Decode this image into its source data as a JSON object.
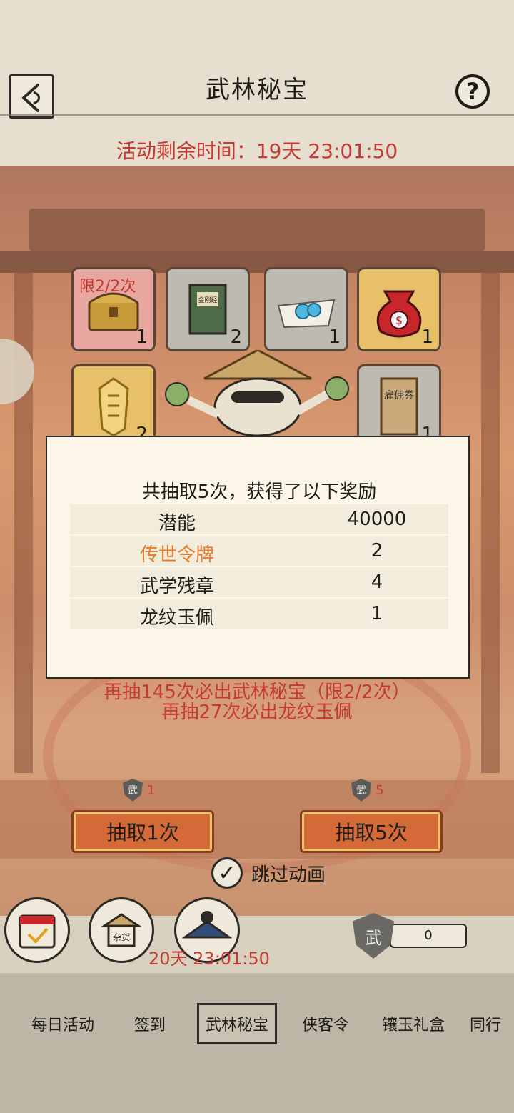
{
  "header": {
    "title": "武林秘宝",
    "help_label": "?",
    "remaining_time": "活动剩余时间：19天 23:01:50"
  },
  "items": [
    {
      "limit": "限2/2次",
      "qty": "1",
      "icon": "treasure-chest-icon"
    },
    {
      "limit": "",
      "qty": "2",
      "icon": "book-icon"
    },
    {
      "limit": "",
      "qty": "1",
      "icon": "pearl-icon"
    },
    {
      "limit": "",
      "qty": "1",
      "icon": "money-bag-icon"
    },
    {
      "limit": "",
      "qty": "2",
      "icon": "token-icon"
    },
    {
      "limit": "",
      "qty": "1",
      "icon": "scroll-icon"
    }
  ],
  "ticket_text": "雇佣券",
  "book_text": "金刚经",
  "modal": {
    "heading": "共抽取5次，获得了以下奖励",
    "rewards": [
      {
        "name": "潜能",
        "value": "40000",
        "highlight": false
      },
      {
        "name": "传世令牌",
        "value": "2",
        "highlight": true
      },
      {
        "name": "武学残章",
        "value": "4",
        "highlight": false
      },
      {
        "name": "龙纹玉佩",
        "value": "1",
        "highlight": false
      }
    ]
  },
  "pity": {
    "line1": "再抽145次必出武林秘宝（限2/2次）",
    "line2": "再抽27次必出龙纹玉佩"
  },
  "draw": {
    "cost_icon": "武",
    "one_cost": "1",
    "one_label": "抽取1次",
    "five_cost": "5",
    "five_label": "抽取5次",
    "skip_label": "跳过动画",
    "skip_checked": true
  },
  "bottom": {
    "timer": "20天 23:01:50",
    "shop_label": "杂货",
    "currency_icon": "武",
    "currency_value": "0"
  },
  "tabs": [
    "每日活动",
    "签到",
    "武林秘宝",
    "侠客令",
    "镶玉礼盒",
    "同行"
  ],
  "active_tab": "武林秘宝",
  "colors": {
    "accent_red": "#c43a32",
    "highlight_orange": "#e57b2b",
    "button_orange": "#d36a38"
  }
}
